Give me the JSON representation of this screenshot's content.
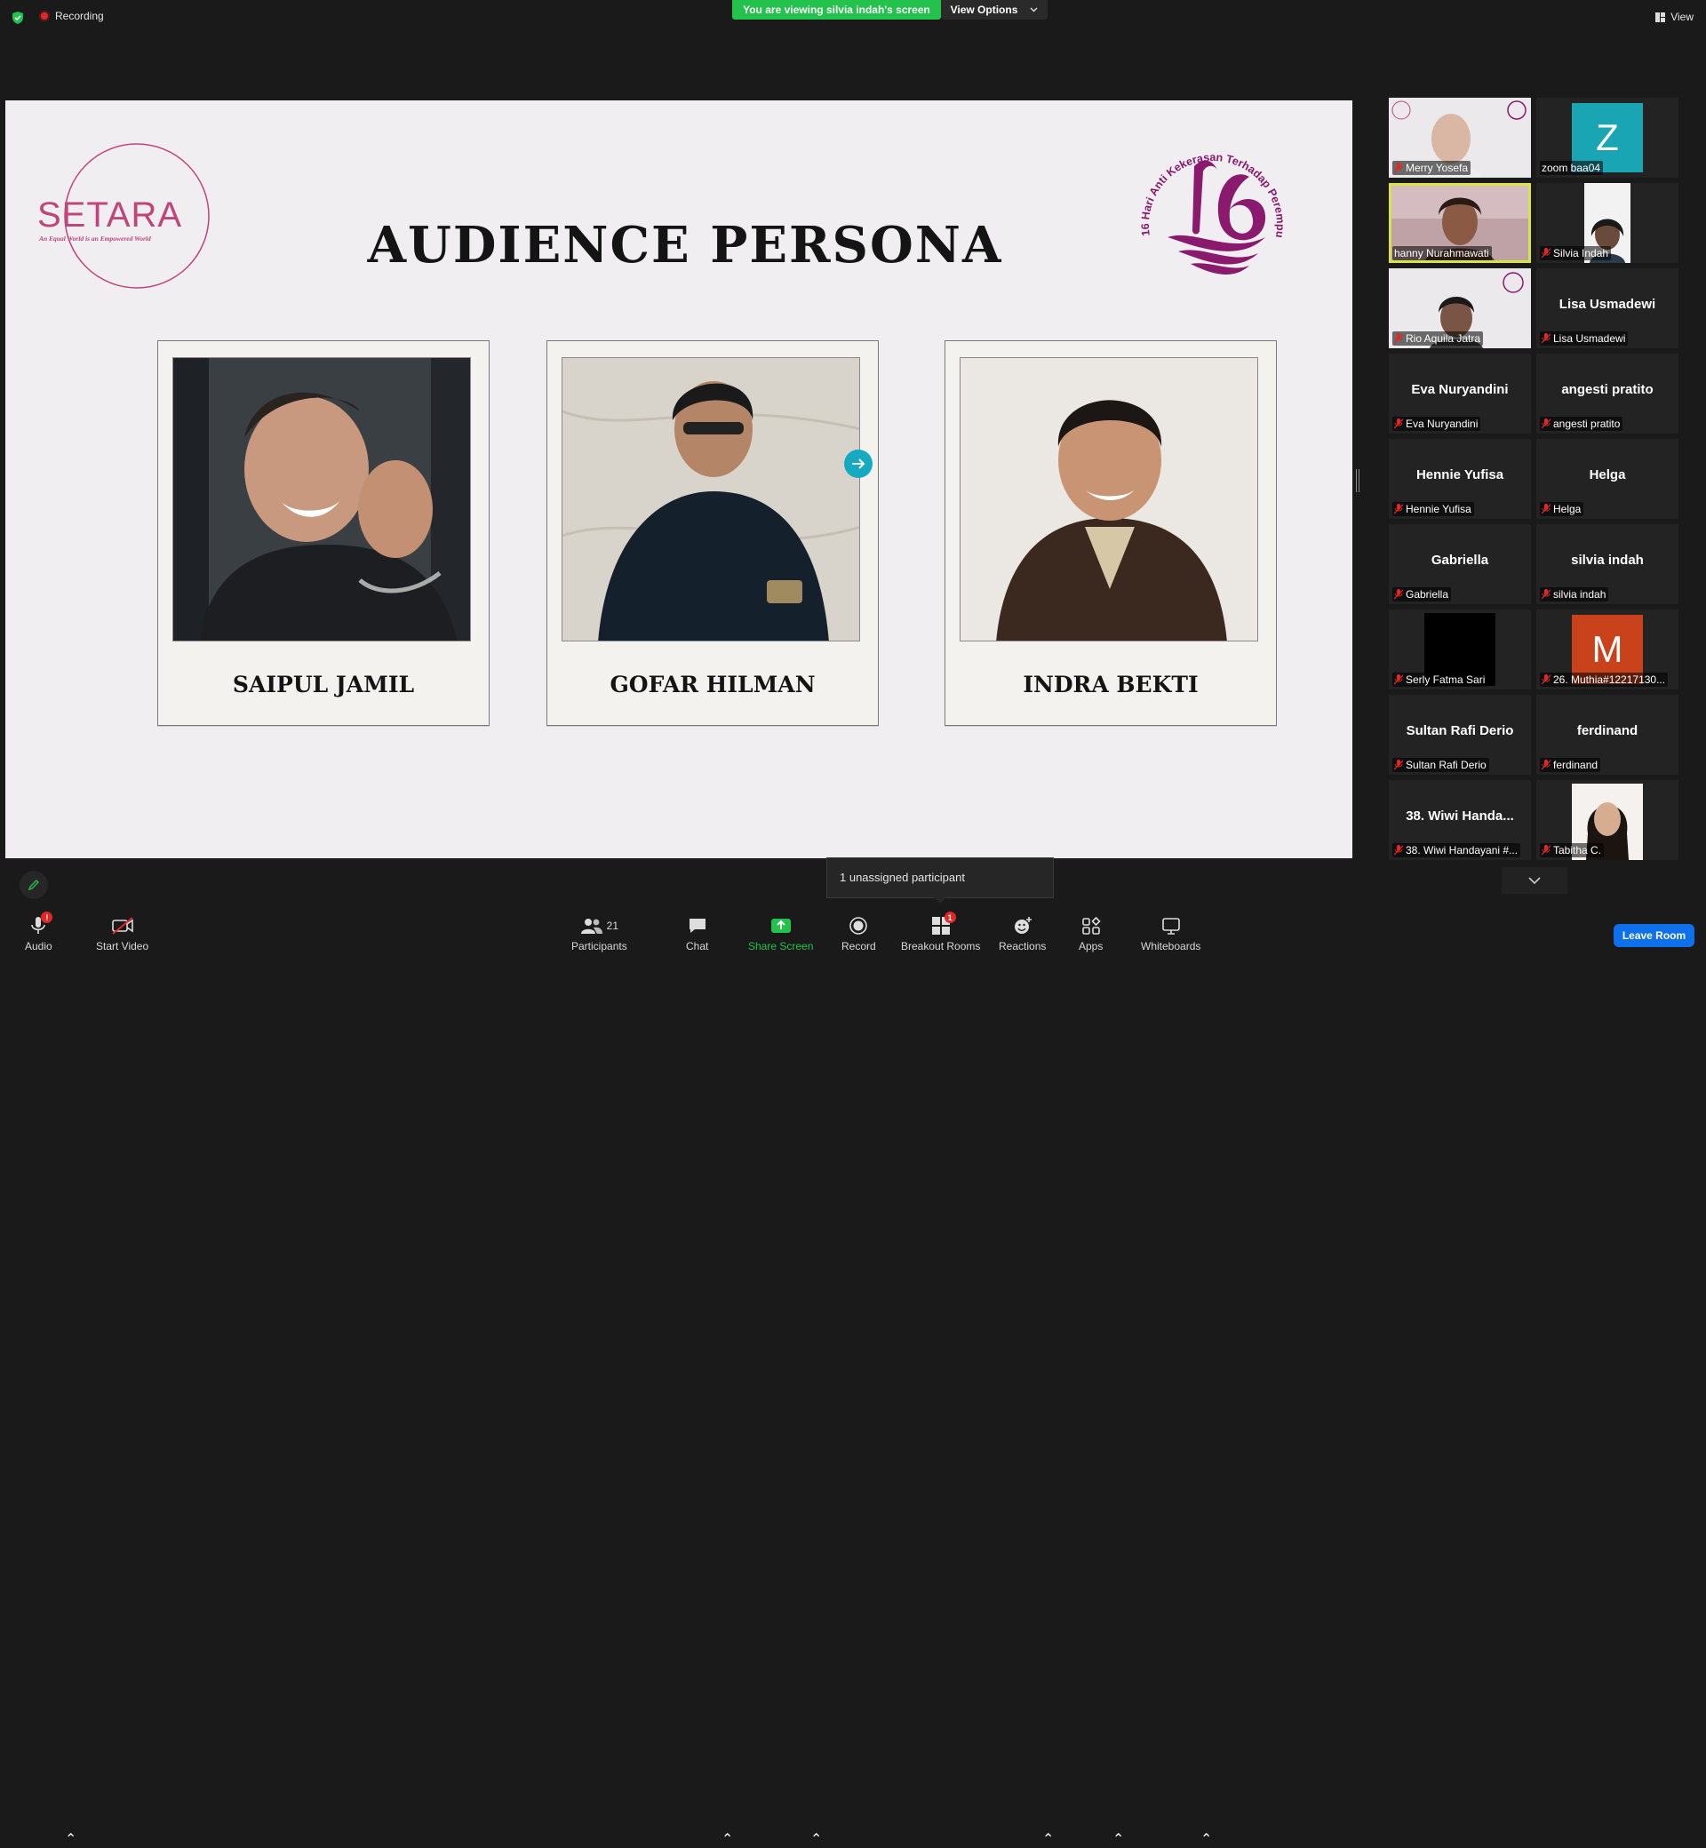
{
  "topbar": {
    "recording_label": "Recording",
    "viewing_banner": "You are viewing silvia indah's screen",
    "view_options_label": "View Options",
    "view_label": "View"
  },
  "slide": {
    "logo_text": "SETARA",
    "logo_tagline": "An Equal World is an Empowered World",
    "logo2_text": "16 Hari Anti Kekerasan Terhadap Perempuan",
    "title": "AUDIENCE PERSONA",
    "personas": [
      {
        "name": "SAIPUL JAMIL"
      },
      {
        "name": "GOFAR HILMAN"
      },
      {
        "name": "INDRA BEKTI"
      }
    ]
  },
  "participants": [
    {
      "label": "Merry Yosefa",
      "big": "",
      "type": "video"
    },
    {
      "label": "zoom baa04",
      "big": "",
      "type": "avatar",
      "letter": "Z",
      "color": "#1aa5b5"
    },
    {
      "label": "hanny Nurahmawati",
      "big": "",
      "type": "video-active"
    },
    {
      "label": "Silvia Indah",
      "big": "",
      "type": "video"
    },
    {
      "label": "Rio Aquila Jatra",
      "big": "",
      "type": "video"
    },
    {
      "label": "Lisa Usmadewi",
      "big": "Lisa Usmadewi",
      "type": "name"
    },
    {
      "label": "Eva Nuryandini",
      "big": "Eva Nuryandini",
      "type": "name"
    },
    {
      "label": "angesti pratito",
      "big": "angesti pratito",
      "type": "name"
    },
    {
      "label": "Hennie Yufisa",
      "big": "Hennie Yufisa",
      "type": "name"
    },
    {
      "label": "Helga",
      "big": "Helga",
      "type": "name"
    },
    {
      "label": "Gabriella",
      "big": "Gabriella",
      "type": "name"
    },
    {
      "label": "silvia indah",
      "big": "silvia indah",
      "type": "name"
    },
    {
      "label": "Serly Fatma Sari",
      "big": "",
      "type": "black"
    },
    {
      "label": "26. Muthia#12217130...",
      "big": "",
      "type": "avatar",
      "letter": "M",
      "color": "#c9421c"
    },
    {
      "label": "Sultan Rafi Derio",
      "big": "Sultan Rafi Derio",
      "type": "name"
    },
    {
      "label": "ferdinand",
      "big": "ferdinand",
      "type": "name"
    },
    {
      "label": "38. Wiwi Handayani #...",
      "big": "38.  Wiwi  Handa...",
      "type": "name"
    },
    {
      "label": "Tabitha C.",
      "big": "",
      "type": "photo"
    }
  ],
  "tooltip": "1 unassigned participant",
  "toolbar": {
    "audio": "Audio",
    "audio_badge": "!",
    "start_video": "Start Video",
    "participants": "Participants",
    "participants_count": "21",
    "chat": "Chat",
    "share_screen": "Share Screen",
    "record": "Record",
    "breakout_rooms": "Breakout Rooms",
    "breakout_badge": "1",
    "reactions": "Reactions",
    "apps": "Apps",
    "whiteboards": "Whiteboards",
    "leave_room": "Leave Room"
  }
}
